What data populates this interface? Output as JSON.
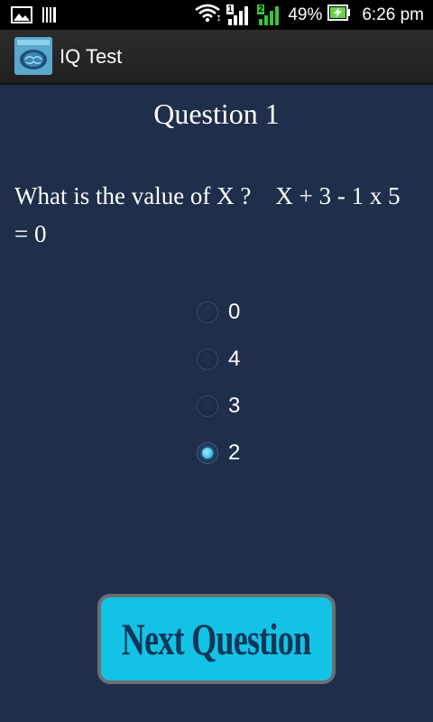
{
  "status_bar": {
    "icons": [
      "image-icon",
      "barcode-icon",
      "wifi-icon",
      "signal-sim1-icon",
      "signal-sim2-icon",
      "battery-charging-icon"
    ],
    "sim1": "1",
    "sim2": "2",
    "battery": "49%",
    "time": "6:26 pm",
    "colors": {
      "sim2_signal": "#3bc43b",
      "battery_fill": "#6ad24a"
    }
  },
  "action_bar": {
    "title": "IQ Test",
    "icon": "brain-app-icon"
  },
  "quiz": {
    "question_title": "Question 1",
    "question_text": "What is the value of X ?    X + 3 - 1 x 5 = 0",
    "options": [
      {
        "label": "0",
        "selected": false
      },
      {
        "label": "4",
        "selected": false
      },
      {
        "label": "3",
        "selected": false
      },
      {
        "label": "2",
        "selected": true
      }
    ],
    "next_button_label": "Next Question"
  },
  "colors": {
    "background": "#1f2e4a",
    "button": "#13c3e6",
    "button_text": "#0e3658",
    "radio_selected": "#1da9e0"
  }
}
